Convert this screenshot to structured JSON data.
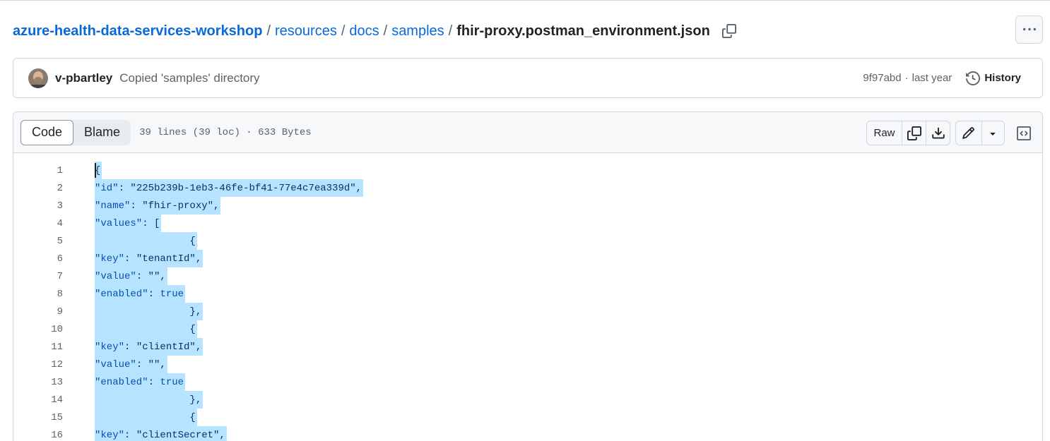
{
  "breadcrumb": {
    "repo": "azure-health-data-services-workshop",
    "parts": [
      "resources",
      "docs",
      "samples"
    ],
    "separator": "/",
    "file": "fhir-proxy.postman_environment.json"
  },
  "commit": {
    "author": "v-pbartley",
    "message": "Copied 'samples' directory",
    "sha": "9f97abd",
    "dot": "·",
    "time": "last year",
    "history_label": "History"
  },
  "file_header": {
    "tabs": [
      "Code",
      "Blame"
    ],
    "active_tab": "Code",
    "meta": "39 lines (39 loc) · 633 Bytes",
    "raw_label": "Raw"
  },
  "code_lines": [
    {
      "n": "1",
      "text": "{"
    },
    {
      "n": "2",
      "text": "\t\"id\": \"225b239b-1eb3-46fe-bf41-77e4c7ea339d\","
    },
    {
      "n": "3",
      "text": "\t\"name\": \"fhir-proxy\","
    },
    {
      "n": "4",
      "text": "\t\"values\": ["
    },
    {
      "n": "5",
      "text": "\t\t{"
    },
    {
      "n": "6",
      "text": "\t\t\t\"key\": \"tenantId\","
    },
    {
      "n": "7",
      "text": "\t\t\t\"value\": \"\","
    },
    {
      "n": "8",
      "text": "\t\t\t\"enabled\": true"
    },
    {
      "n": "9",
      "text": "\t\t},"
    },
    {
      "n": "10",
      "text": "\t\t{"
    },
    {
      "n": "11",
      "text": "\t\t\t\"key\": \"clientId\","
    },
    {
      "n": "12",
      "text": "\t\t\t\"value\": \"\","
    },
    {
      "n": "13",
      "text": "\t\t\t\"enabled\": true"
    },
    {
      "n": "14",
      "text": "\t\t},"
    },
    {
      "n": "15",
      "text": "\t\t{"
    },
    {
      "n": "16",
      "text": "\t\t\t\"key\": \"clientSecret\","
    }
  ],
  "icons": {
    "copy": "copy-icon",
    "more": "kebab-horizontal-icon",
    "history": "history-icon",
    "download": "download-icon",
    "edit": "pencil-icon",
    "dropdown": "triangle-down-icon",
    "symbols": "code-square-icon"
  },
  "colors": {
    "link": "#0969da",
    "selection": "#b6e3ff"
  }
}
